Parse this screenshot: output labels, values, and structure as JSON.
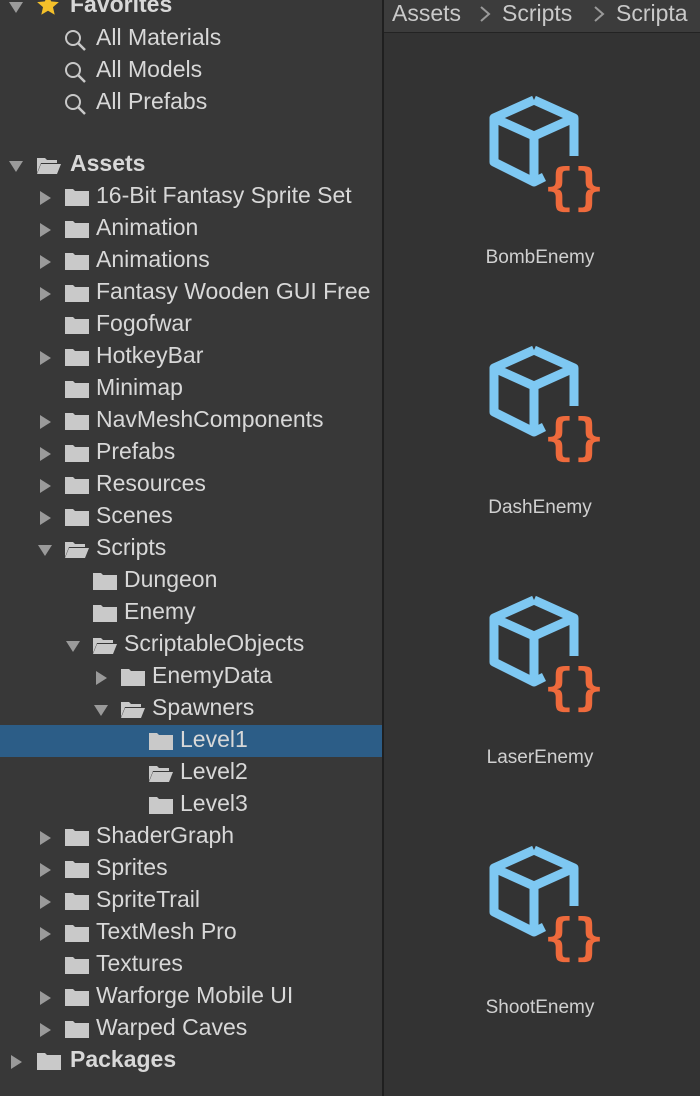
{
  "favorites": {
    "title": "Favorites",
    "items": [
      {
        "label": "All Materials",
        "icon": "search-icon"
      },
      {
        "label": "All Models",
        "icon": "search-icon"
      },
      {
        "label": "All Prefabs",
        "icon": "search-icon"
      }
    ]
  },
  "assets_root": {
    "label": "Assets",
    "expanded": true
  },
  "folders": [
    {
      "label": "16-Bit Fantasy Sprite Set",
      "expandable": true
    },
    {
      "label": "Animation",
      "expandable": true
    },
    {
      "label": "Animations",
      "expandable": true
    },
    {
      "label": "Fantasy Wooden GUI  Free",
      "expandable": true
    },
    {
      "label": "Fogofwar",
      "expandable": false
    },
    {
      "label": "HotkeyBar",
      "expandable": true
    },
    {
      "label": "Minimap",
      "expandable": false
    },
    {
      "label": "NavMeshComponents",
      "expandable": true
    },
    {
      "label": "Prefabs",
      "expandable": true
    },
    {
      "label": "Resources",
      "expandable": true
    },
    {
      "label": "Scenes",
      "expandable": true
    },
    {
      "label": "Scripts",
      "expandable": true,
      "expanded": true
    },
    {
      "label": "Dungeon",
      "expandable": false
    },
    {
      "label": "Enemy",
      "expandable": false
    },
    {
      "label": "ScriptableObjects",
      "expandable": true,
      "expanded": true
    },
    {
      "label": "EnemyData",
      "expandable": true
    },
    {
      "label": "Spawners",
      "expandable": true,
      "expanded": true
    },
    {
      "label": "Level1",
      "expandable": false,
      "selected": true
    },
    {
      "label": "Level2",
      "expandable": false,
      "open_folder": true
    },
    {
      "label": "Level3",
      "expandable": false
    },
    {
      "label": "ShaderGraph",
      "expandable": true
    },
    {
      "label": "Sprites",
      "expandable": true
    },
    {
      "label": "SpriteTrail",
      "expandable": true
    },
    {
      "label": "TextMesh Pro",
      "expandable": true
    },
    {
      "label": "Textures",
      "expandable": false
    },
    {
      "label": "Warforge Mobile UI",
      "expandable": true
    },
    {
      "label": "Warped Caves",
      "expandable": true
    }
  ],
  "packages_root": {
    "label": "Packages",
    "expanded": false
  },
  "breadcrumb": [
    "Assets",
    "Scripts",
    "Scripta"
  ],
  "assets": [
    {
      "name": "BombEnemy",
      "icon": "script-icon"
    },
    {
      "name": "DashEnemy",
      "icon": "script-icon"
    },
    {
      "name": "LaserEnemy",
      "icon": "script-icon"
    },
    {
      "name": "ShootEnemy",
      "icon": "script-icon"
    }
  ],
  "colors": {
    "selection": "#2c5d87",
    "script_cube": "#7ec8f2",
    "script_braces": "#ee6a3c",
    "star": "#f4c02a"
  }
}
